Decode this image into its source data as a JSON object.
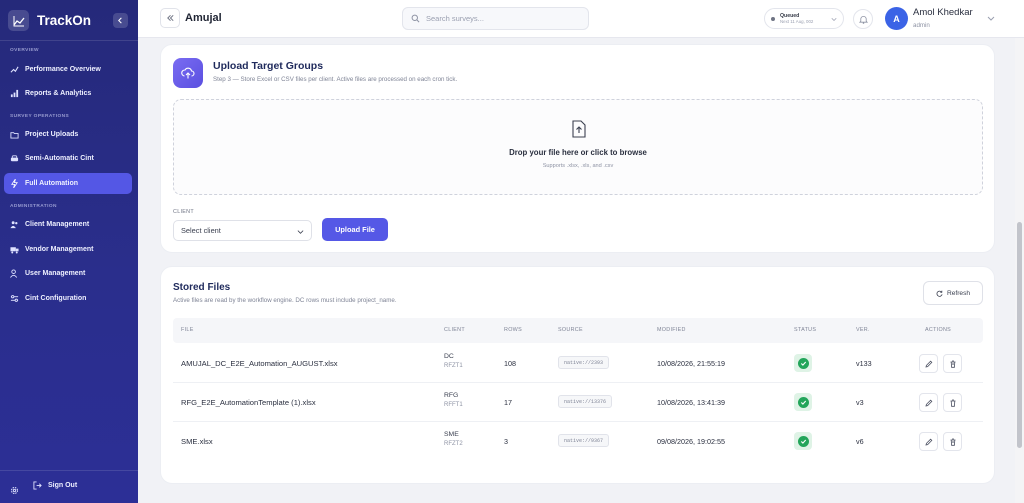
{
  "app": {
    "name": "TrackOn"
  },
  "sidebar": {
    "sections": [
      {
        "title": "OVERVIEW"
      },
      {
        "title": "SURVEY OPERATIONS"
      },
      {
        "title": "ADMINISTRATION"
      }
    ],
    "items": [
      {
        "label": "Performance Overview",
        "icon": "trend-icon"
      },
      {
        "label": "Reports & Analytics",
        "icon": "bar-chart-icon"
      },
      {
        "label": "Project Uploads",
        "icon": "upload-icon"
      },
      {
        "label": "Semi-Automatic Cint",
        "icon": "car-icon"
      },
      {
        "label": "Full Automation",
        "icon": "lightning-icon",
        "active": true
      },
      {
        "label": "Client Management",
        "icon": "users-icon"
      },
      {
        "label": "Vendor Management",
        "icon": "truck-icon"
      },
      {
        "label": "User Management",
        "icon": "user-cog-icon"
      },
      {
        "label": "Cint Configuration",
        "icon": "sliders-icon"
      }
    ],
    "sign_out": "Sign Out"
  },
  "header": {
    "title": "Amujal",
    "search_placeholder": "Search surveys...",
    "queue_status": "Queued",
    "queue_next": "Next 11 Aug, 002",
    "user_initial": "A",
    "user_name": "Amol Khedkar",
    "user_role": "admin"
  },
  "upload": {
    "title": "Upload Target Groups",
    "subtitle": "Step 3 — Store Excel or CSV files per client. Active files are processed on each cron tick.",
    "drop_title": "Drop your file here or click to browse",
    "drop_sub": "Supports .xlsx, .xls, and .csv",
    "client_label": "CLIENT",
    "client_value": "Select client",
    "upload_button": "Upload File"
  },
  "files": {
    "title": "Stored Files",
    "subtitle": "Active files are read by the workflow engine. DC rows must include project_name.",
    "refresh_label": "Refresh",
    "columns": [
      "FILE",
      "CLIENT",
      "ROWS",
      "SOURCE",
      "MODIFIED",
      "STATUS",
      "VER.",
      "ACTIONS"
    ],
    "rows": [
      {
        "file": "AMUJAL_DC_E2E_Automation_AUGUST.xlsx",
        "client": "DC",
        "client_sub": "RFZT1",
        "rows": "108",
        "source": "native://2393",
        "modified": "10/08/2026, 21:55:19",
        "status": "active",
        "ver": "v133"
      },
      {
        "file": "RFG_E2E_AutomationTemplate (1).xlsx",
        "client": "RFG",
        "client_sub": "RFFT1",
        "rows": "17",
        "source": "native://13376",
        "modified": "10/08/2026, 13:41:39",
        "status": "active",
        "ver": "v3"
      },
      {
        "file": "SME.xlsx",
        "client": "SME",
        "client_sub": "RFZT2",
        "rows": "3",
        "source": "native://9367",
        "modified": "09/08/2026, 19:02:55",
        "status": "active",
        "ver": "v6"
      }
    ]
  },
  "colors": {
    "accent": "#5558e6",
    "sidebar": "#2a2e8c",
    "status_ok": "#23a55a"
  }
}
